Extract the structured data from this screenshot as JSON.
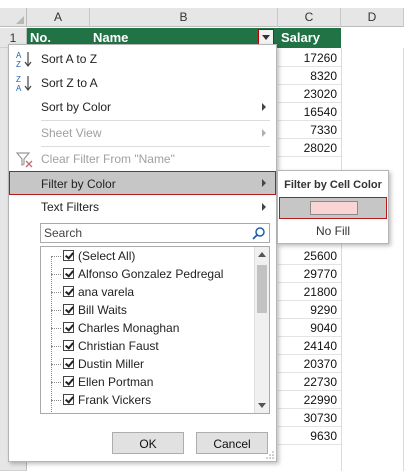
{
  "sheet": {
    "columns": [
      "A",
      "B",
      "C",
      "D"
    ],
    "row_number": "1",
    "headers": {
      "no": "No.",
      "name": "Name",
      "salary": "Salary"
    },
    "salaries": [
      "17260",
      "8320",
      "23020",
      "16540",
      "7330",
      "28020",
      "25600",
      "29770",
      "21800",
      "9290",
      "9040",
      "24140",
      "20370",
      "22730",
      "22990",
      "30730",
      "9630"
    ]
  },
  "menu": {
    "sort_az": "Sort A to Z",
    "sort_za": "Sort Z to A",
    "sort_by_color": "Sort by Color",
    "sheet_view": "Sheet View",
    "clear_filter": "Clear Filter From \"Name\"",
    "filter_by_color": "Filter by Color",
    "text_filters": "Text Filters",
    "search_placeholder": "Search",
    "list": [
      {
        "label": "(Select All)",
        "checked": true
      },
      {
        "label": "Alfonso Gonzalez Pedregal",
        "checked": true
      },
      {
        "label": "ana varela",
        "checked": true
      },
      {
        "label": "Bill Waits",
        "checked": true
      },
      {
        "label": "Charles Monaghan",
        "checked": true
      },
      {
        "label": "Christian Faust",
        "checked": true
      },
      {
        "label": "Dustin Miller",
        "checked": true
      },
      {
        "label": "Ellen Portman",
        "checked": true
      },
      {
        "label": "Frank Vickers",
        "checked": true
      }
    ],
    "ok": "OK",
    "cancel": "Cancel"
  },
  "submenu": {
    "title": "Filter by Cell Color",
    "swatch_color": "#f9d5d3",
    "no_fill": "No Fill"
  },
  "colors": {
    "header_green": "#217346",
    "highlight_border": "#b31b1b",
    "highlight_bg": "#c6c6c6"
  }
}
